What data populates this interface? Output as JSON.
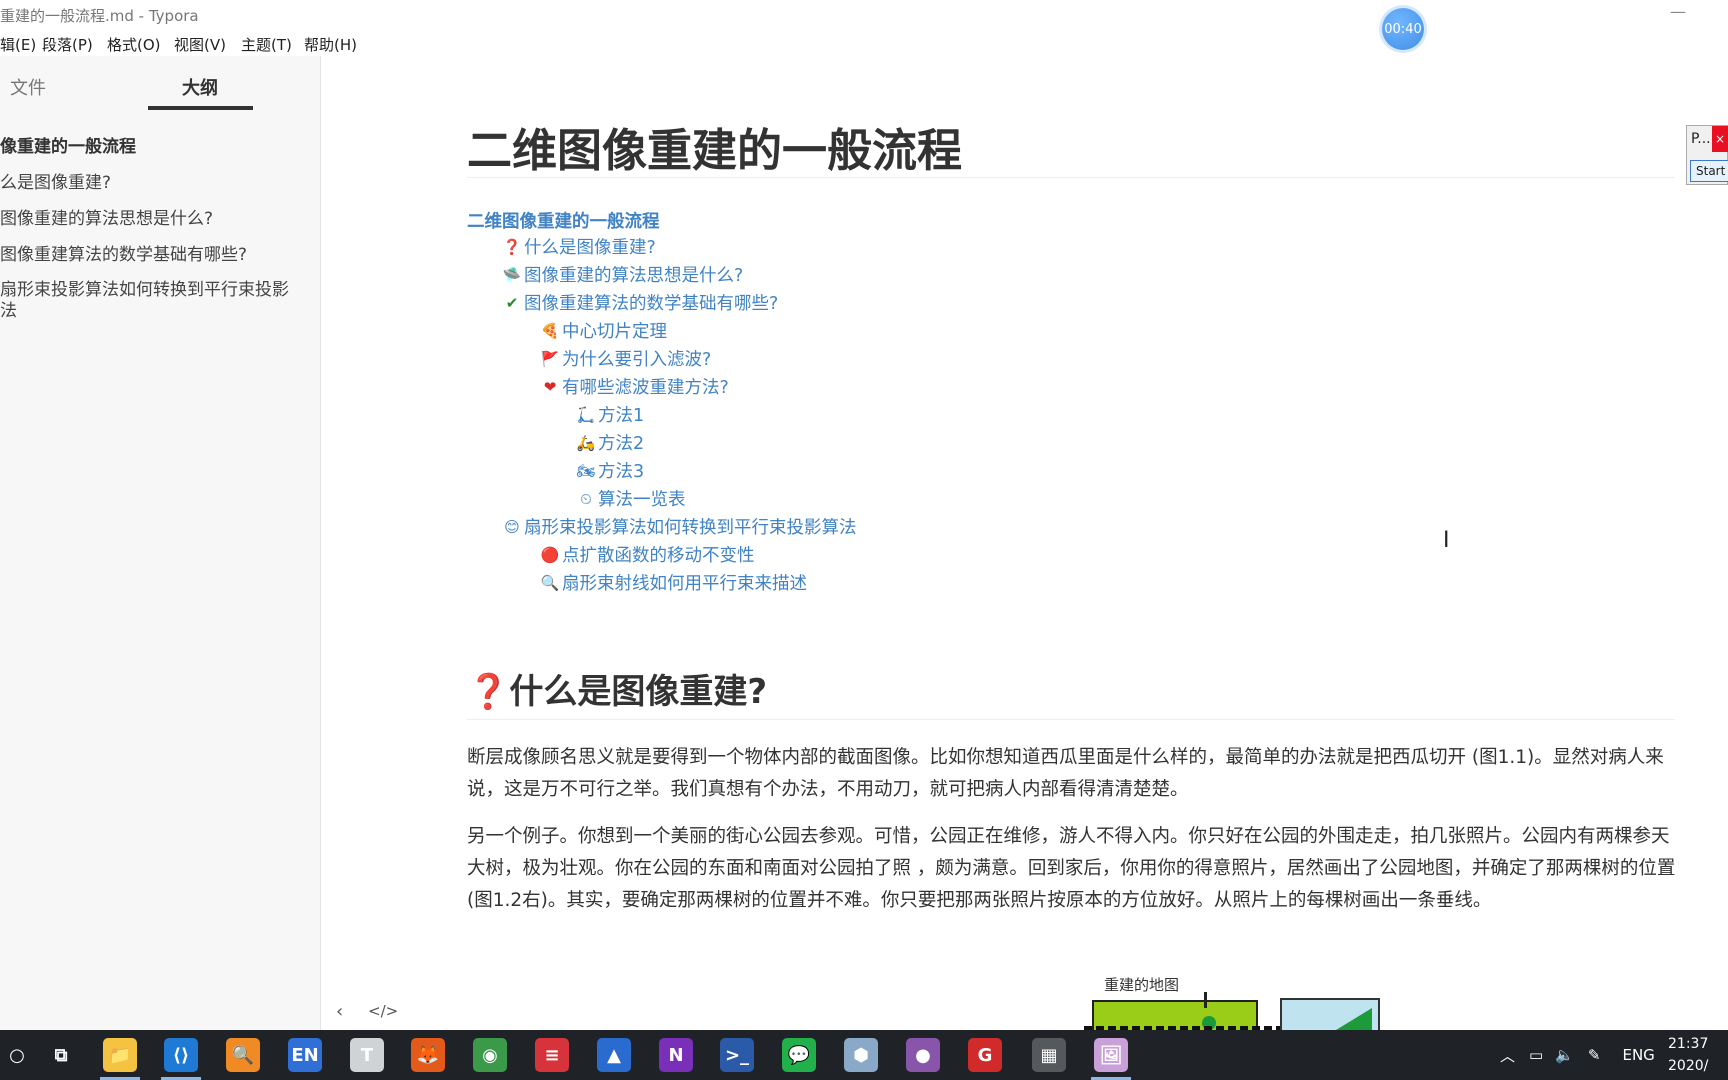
{
  "window": {
    "title": "重建的一般流程.md - Typora"
  },
  "menu": [
    "辑(E)",
    "段落(P)",
    "格式(O)",
    "视图(V)",
    "主题(T)",
    "帮助(H)"
  ],
  "timer": "00:40",
  "sidebar": {
    "tabs": [
      "文件",
      "大纲"
    ],
    "outline": [
      "像重建的一般流程",
      "么是图像重建?",
      "图像重建的算法思想是什么?",
      "图像重建算法的数学基础有哪些?",
      "扇形束投影算法如何转换到平行束投影",
      "法"
    ]
  },
  "doc": {
    "title": "二维图像重建的一般流程",
    "toc": [
      {
        "icon": "none",
        "text": "二维图像重建的一般流程"
      },
      {
        "icon": "question-mark-icon",
        "glyph": "❓",
        "text": "什么是图像重建?"
      },
      {
        "icon": "flying-saucer-icon",
        "glyph": "🛸",
        "text": "图像重建的算法思想是什么?"
      },
      {
        "icon": "check-mark-icon",
        "glyph": "✔",
        "text": "图像重建算法的数学基础有哪些?"
      },
      {
        "icon": "pizza-icon",
        "glyph": "🍕",
        "text": "中心切片定理"
      },
      {
        "icon": "flag-icon",
        "glyph": "🚩",
        "text": "为什么要引入滤波?"
      },
      {
        "icon": "heart-icon",
        "glyph": "❤",
        "text": "有哪些滤波重建方法?"
      },
      {
        "icon": "scooter-icon",
        "glyph": "🛴",
        "text": "方法1"
      },
      {
        "icon": "motor-scooter-icon",
        "glyph": "🛵",
        "text": "方法2"
      },
      {
        "icon": "motorcycle-icon",
        "glyph": "🏍",
        "text": "方法3"
      },
      {
        "icon": "stopwatch-icon",
        "glyph": "⏲",
        "text": "算法一览表"
      },
      {
        "icon": "face-icon",
        "glyph": "😊",
        "text": "扇形束投影算法如何转换到平行束投影算法"
      },
      {
        "icon": "red-circle-icon",
        "glyph": "🔴",
        "text": "点扩散函数的移动不变性"
      },
      {
        "icon": "magnifier-icon",
        "glyph": "🔍",
        "text": "扇形束射线如何用平行束来描述"
      }
    ],
    "h2": "什么是图像重建?",
    "h2_mark": "❓",
    "paragraphs": [
      "断层成像顾名思义就是要得到一个物体内部的截面图像。比如你想知道西瓜里面是什么样的，最简单的办法就是把西瓜切开 (图1.1)。显然对病人来说，这是万不可行之举。我们真想有个办法，不用动刀，就可把病人内部看得清清楚楚。",
      "另一个例子。你想到一个美丽的街心公园去参观。可惜，公园正在维修，游人不得入内。你只好在公园的外围走走，拍几张照片。公园内有两棵参天大树，极为壮观。你在公园的东面和南面对公园拍了照 ，颇为满意。回到家后，你用你的得意照片，居然画出了公园地图，并确定了那两棵树的位置 (图1.2右)。其实，要确定那两棵树的位置并不难。你只要把那两张照片按原本的方位放好。从照片上的每棵树画出一条垂线。"
    ],
    "figure_label": "重建的地图"
  },
  "floatpanel": {
    "label": "P...",
    "close": "×",
    "start": "Start"
  },
  "statusbar": {
    "prev": "‹",
    "source": "</>"
  },
  "taskbar": {
    "icons": [
      {
        "name": "cortana-icon",
        "glyph": "○",
        "bg": "transparent"
      },
      {
        "name": "task-view-icon",
        "glyph": "⧉",
        "bg": "transparent"
      },
      {
        "name": "file-explorer-icon",
        "glyph": "📁",
        "bg": "#f5c342"
      },
      {
        "name": "vscode-icon",
        "glyph": "⟨⟩",
        "bg": "#1f7ad6"
      },
      {
        "name": "search-tool-icon",
        "glyph": "🔍",
        "bg": "#f08a24"
      },
      {
        "name": "en-dict-icon",
        "glyph": "EN",
        "bg": "#2f6fd6"
      },
      {
        "name": "typora-icon",
        "glyph": "T",
        "bg": "#cfd3d6"
      },
      {
        "name": "firefox-icon",
        "glyph": "🦊",
        "bg": "#e35a1b"
      },
      {
        "name": "chrome-icon",
        "glyph": "◉",
        "bg": "#3a9a4a"
      },
      {
        "name": "stack-app-icon",
        "glyph": "≡",
        "bg": "#d6343a"
      },
      {
        "name": "matlab-icon",
        "glyph": "▲",
        "bg": "#2a6bd0"
      },
      {
        "name": "onenote-icon",
        "glyph": "N",
        "bg": "#7a2fb8"
      },
      {
        "name": "powershell-icon",
        "glyph": ">_",
        "bg": "#2a5aa8"
      },
      {
        "name": "wechat-icon",
        "glyph": "💬",
        "bg": "#22b04a"
      },
      {
        "name": "cube-app-icon",
        "glyph": "⬢",
        "bg": "#8aa8c8"
      },
      {
        "name": "github-icon",
        "glyph": "●",
        "bg": "#8855aa"
      },
      {
        "name": "red-app-icon",
        "glyph": "G",
        "bg": "#d02a2a"
      },
      {
        "name": "calculator-icon",
        "glyph": "▦",
        "bg": "#55595c"
      },
      {
        "name": "photos-icon",
        "glyph": "🖼",
        "bg": "#c9a0d8"
      }
    ],
    "lang": "ENG",
    "time": "21:37",
    "date": "2020/"
  }
}
